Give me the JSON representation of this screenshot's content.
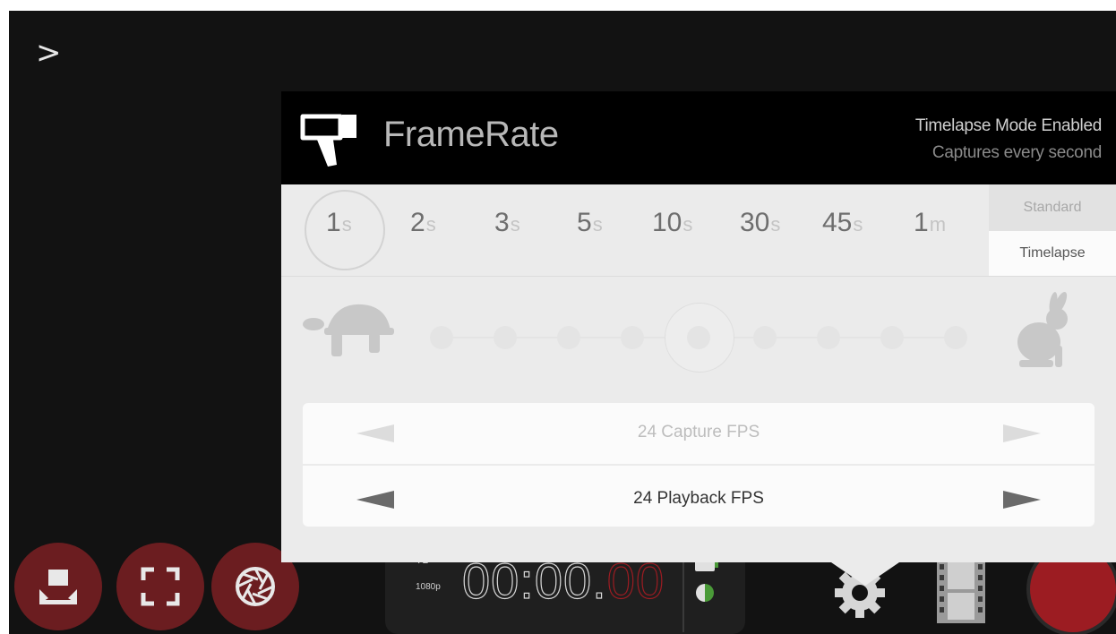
{
  "nav": {
    "back_icon": "chevron-right-icon"
  },
  "panel": {
    "title": "FrameRate",
    "status_line1": "Timelapse Mode Enabled",
    "status_line2": "Captures every second",
    "intervals": [
      {
        "value": "1",
        "unit": "s",
        "selected": true
      },
      {
        "value": "2",
        "unit": "s",
        "selected": false
      },
      {
        "value": "3",
        "unit": "s",
        "selected": false
      },
      {
        "value": "5",
        "unit": "s",
        "selected": false
      },
      {
        "value": "10",
        "unit": "s",
        "selected": false
      },
      {
        "value": "30",
        "unit": "s",
        "selected": false
      },
      {
        "value": "45",
        "unit": "s",
        "selected": false
      },
      {
        "value": "1",
        "unit": "m",
        "selected": false
      }
    ],
    "modes": {
      "standard": "Standard",
      "timelapse": "Timelapse",
      "active": "Timelapse"
    },
    "speed": {
      "slow_icon": "turtle-icon",
      "fast_icon": "rabbit-icon",
      "positions": 9,
      "selected_index": 4
    },
    "fps": {
      "capture_label": "24 Capture FPS",
      "playback_label": "24 Playback FPS"
    }
  },
  "bottom_bar": {
    "timecode": {
      "line1": "TL",
      "line2": "1080p",
      "main": "00:00.",
      "frames": "00"
    },
    "buttons": [
      "focus-frame-icon",
      "fullscreen-icon",
      "aperture-icon",
      "settings-gear-icon",
      "film-strip-icon",
      "record-button"
    ]
  },
  "colors": {
    "accent_red": "#9c1c22",
    "dark_red": "#6b1d20",
    "panel_bg": "#ebebeb",
    "header_bg": "#000000",
    "storage_green": "#4a9a38"
  }
}
